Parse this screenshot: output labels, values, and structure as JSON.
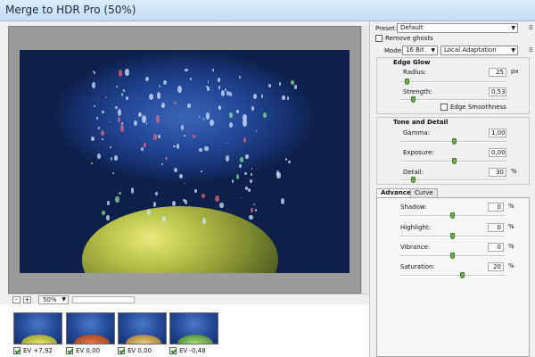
{
  "window": {
    "title": "Merge to HDR Pro (50%)"
  },
  "canvas": {
    "zoom": "50%",
    "zoom_out": "-",
    "zoom_in": "+"
  },
  "thumbnails": [
    {
      "label": "EV +7,92",
      "checked": true
    },
    {
      "label": "EV 0,00",
      "checked": true
    },
    {
      "label": "EV 0,00",
      "checked": true
    },
    {
      "label": "EV -0,48",
      "checked": true
    }
  ],
  "panel": {
    "preset_label": "Preset:",
    "preset_value": "Default",
    "remove_ghosts": "Remove ghosts",
    "mode_label": "Mode:",
    "bit_depth": "16 Bit",
    "method": "Local Adaptation",
    "edge_glow": {
      "title": "Edge Glow",
      "radius_label": "Radius:",
      "radius": "25",
      "radius_unit": "px",
      "radius_level": 0.04,
      "strength_label": "Strength:",
      "strength": "0,53",
      "strength_level": 0.1,
      "edge_smoothness": "Edge Smoothness"
    },
    "tone_detail": {
      "title": "Tone and Detail",
      "gamma_label": "Gamma:",
      "gamma": "1,00",
      "gamma_level": 0.5,
      "exposure_label": "Exposure:",
      "exposure": "0,00",
      "exposure_level": 0.5,
      "detail_label": "Detail:",
      "detail": "30",
      "detail_unit": "%",
      "detail_level": 0.1
    },
    "tabs": {
      "advanced": "Advanced",
      "curve": "Curve"
    },
    "advanced": {
      "shadow_label": "Shadow:",
      "shadow": "0",
      "shadow_level": 0.5,
      "highlight_label": "Highlight:",
      "highlight": "0",
      "highlight_level": 0.5,
      "vibrance_label": "Vibrance:",
      "vibrance": "0",
      "vibrance_level": 0.5,
      "saturation_label": "Saturation:",
      "saturation": "20",
      "saturation_level": 0.6,
      "unit": "%"
    }
  },
  "colors": {
    "slider_thumb": "#6fae52",
    "titlebar": "#c3dcf4"
  }
}
